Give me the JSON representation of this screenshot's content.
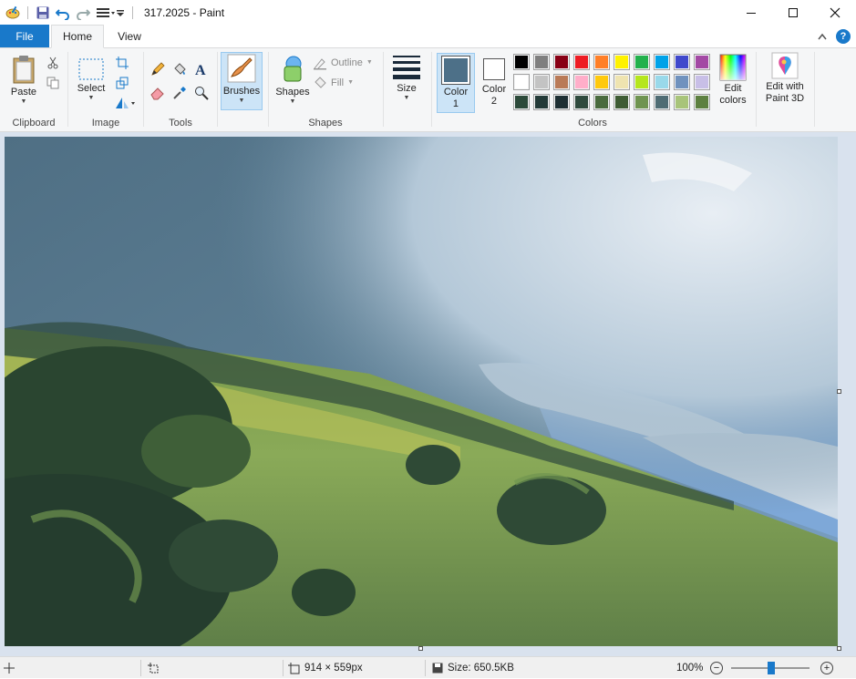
{
  "window": {
    "title": "317.2025 - Paint"
  },
  "quick_access": {
    "icons": [
      "paint-app-icon",
      "save-icon",
      "undo-icon",
      "redo-icon",
      "customize-icon"
    ]
  },
  "tabs": {
    "file": "File",
    "home": "Home",
    "view": "View"
  },
  "ribbon": {
    "clipboard": {
      "paste": "Paste",
      "group_label": "Clipboard"
    },
    "image": {
      "select": "Select",
      "group_label": "Image"
    },
    "tools": {
      "group_label": "Tools"
    },
    "brushes": {
      "label": "Brushes"
    },
    "shapes": {
      "label": "Shapes",
      "outline": "Outline",
      "fill": "Fill",
      "group_label": "Shapes"
    },
    "size": {
      "label": "Size"
    },
    "colors": {
      "color1_label": "Color 1",
      "color1_line1": "Color",
      "color1_line2": "1",
      "color2_line1": "Color",
      "color2_line2": "2",
      "color1_value": "#4d7088",
      "color2_value": "#ffffff",
      "group_label": "Colors",
      "edit_colors_line1": "Edit",
      "edit_colors_line2": "colors",
      "palette_row1": [
        "#000000",
        "#7f7f7f",
        "#880015",
        "#ed1c24",
        "#ff7f27",
        "#fff200",
        "#22b14c",
        "#00a2e8",
        "#3f48cc",
        "#a349a4"
      ],
      "palette_row2": [
        "#ffffff",
        "#c3c3c3",
        "#b97a57",
        "#ffaec9",
        "#ffc90e",
        "#efe4b0",
        "#b5e61d",
        "#99d9ea",
        "#7092be",
        "#c8bfe7"
      ],
      "palette_row3": [
        "#2c4a3a",
        "#233a38",
        "#1e2f33",
        "#2f4a3d",
        "#4a6b3e",
        "#3e5c34",
        "#6f9450",
        "#4f6c73",
        "#a8c47a",
        "#5d8040"
      ]
    },
    "paint3d": {
      "line1": "Edit with",
      "line2": "Paint 3D"
    }
  },
  "status": {
    "dimensions": "914 × 559px",
    "size": "Size: 650.5KB",
    "zoom": "100%"
  }
}
